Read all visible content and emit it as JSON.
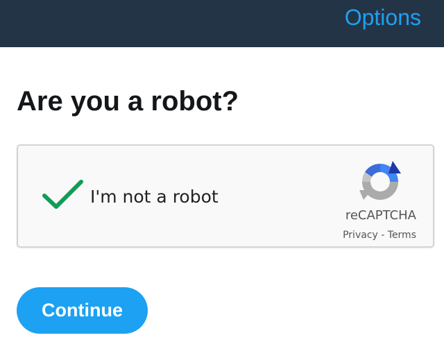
{
  "header": {
    "options_label": "Options",
    "background_color": "#243447",
    "accent_color": "#1da1f2"
  },
  "main": {
    "title": "Are you a robot?"
  },
  "recaptcha": {
    "checkbox_label": "I'm not a robot",
    "checked": true,
    "check_icon": "green-checkmark-icon",
    "logo_icon": "recaptcha-logo-icon",
    "brand": "reCAPTCHA",
    "privacy_label": "Privacy",
    "separator": " - ",
    "terms_label": "Terms",
    "check_color": "#0f9d58"
  },
  "actions": {
    "continue_label": "Continue",
    "button_color": "#1da1f2"
  }
}
